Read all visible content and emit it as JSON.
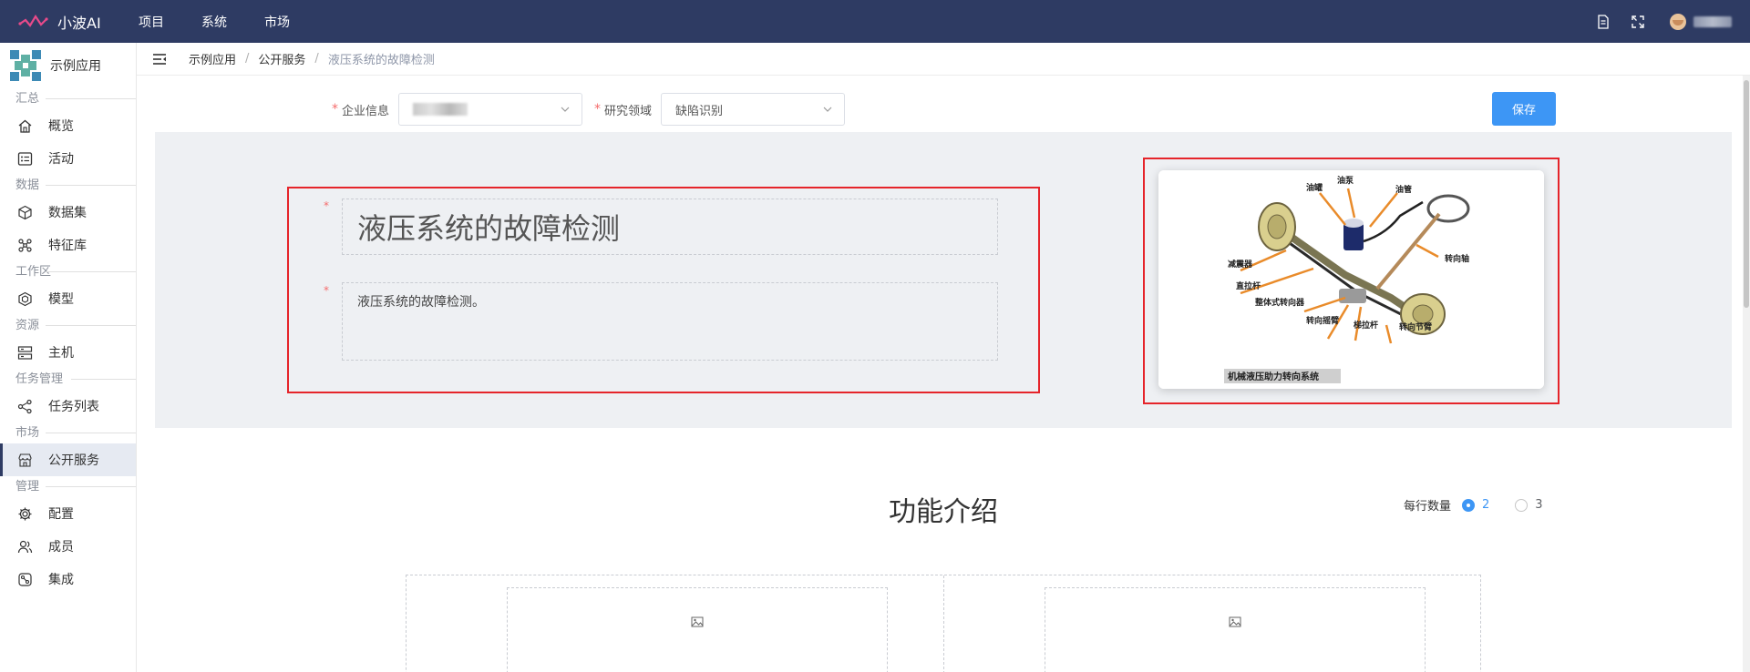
{
  "brand": {
    "name": "小波AI"
  },
  "topnav": [
    {
      "label": "项目"
    },
    {
      "label": "系统"
    },
    {
      "label": "市场"
    }
  ],
  "sidebar": {
    "app_name": "示例应用",
    "groups": [
      {
        "label": "汇总",
        "items": [
          {
            "label": "概览",
            "icon": "home-icon"
          },
          {
            "label": "活动",
            "icon": "activity-icon"
          }
        ]
      },
      {
        "label": "数据",
        "items": [
          {
            "label": "数据集",
            "icon": "cube-icon"
          },
          {
            "label": "特征库",
            "icon": "feature-icon"
          }
        ]
      },
      {
        "label": "工作区",
        "items": [
          {
            "label": "模型",
            "icon": "model-icon"
          }
        ]
      },
      {
        "label": "资源",
        "items": [
          {
            "label": "主机",
            "icon": "server-icon"
          }
        ]
      },
      {
        "label": "任务管理",
        "items": [
          {
            "label": "任务列表",
            "icon": "task-icon"
          }
        ]
      },
      {
        "label": "市场",
        "items": [
          {
            "label": "公开服务",
            "icon": "store-icon",
            "active": true
          }
        ]
      },
      {
        "label": "管理",
        "items": [
          {
            "label": "配置",
            "icon": "gear-icon"
          },
          {
            "label": "成员",
            "icon": "members-icon"
          },
          {
            "label": "集成",
            "icon": "integration-icon"
          }
        ]
      }
    ]
  },
  "breadcrumb": [
    "示例应用",
    "公开服务",
    "液压系统的故障检测"
  ],
  "breadcrumb_sep": "/",
  "form": {
    "enterprise_label": "企业信息",
    "research_label": "研究领域",
    "research_value": "缺陷识别",
    "required_mark": "*"
  },
  "save_label": "保存",
  "hero": {
    "title": "液压系统的故障检测",
    "description": "液压系统的故障检测。"
  },
  "diagram": {
    "caption": "机械液压助力转向系统",
    "labels": [
      "油罐",
      "油泵",
      "油管",
      "转向轴",
      "减震器",
      "直拉杆",
      "整体式转向器",
      "转向摇臂",
      "梯拉杆",
      "转向节臂"
    ]
  },
  "features": {
    "title": "功能介绍",
    "per_row_label": "每行数量",
    "options": [
      "2",
      "3"
    ],
    "selected": "2"
  },
  "colors": {
    "topbar": "#2e3b63",
    "accent": "#3d96f5",
    "highlight_border": "#e5242a",
    "hero_bg": "#eef0f3"
  }
}
